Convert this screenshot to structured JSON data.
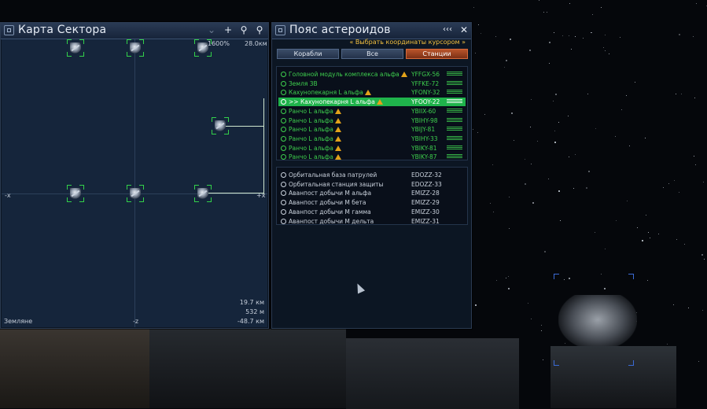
{
  "sector_map": {
    "title": "Карта Сектора",
    "zoom": "1600%",
    "range": "28.0км",
    "axis_neg_x": "-x",
    "axis_pos_x": "+x",
    "axis_neg_z": "-z",
    "sector_name": "Земляне",
    "scale_1": "19.7 км",
    "scale_2": "532 м",
    "scale_3": "-48.7 км",
    "object_icons": [
      "station-icon",
      "station-icon",
      "station-icon",
      "station-icon",
      "station-icon",
      "station-icon",
      "station-icon"
    ]
  },
  "asteroid_panel": {
    "title": "Пояс астероидов",
    "cursor_link": "« Выбрать координаты курсором »",
    "tabs": [
      "Корабли",
      "Все",
      "Станции"
    ],
    "active_tab": "Станции",
    "owned": [
      {
        "name": "Головной модуль комплекса альфа",
        "code": "YFFGX-56",
        "warn": true,
        "selected": false
      },
      {
        "name": "Земля 3В",
        "code": "YFFKE-72",
        "warn": false,
        "selected": false
      },
      {
        "name": "Кахунопекарня L альфа",
        "code": "YFONY-32",
        "warn": true,
        "selected": false
      },
      {
        "name": ">> Кахунопекарня L альфа",
        "code": "YFOOY-22",
        "warn": true,
        "selected": true
      },
      {
        "name": "Ранчо L альфа",
        "code": "YBIIX-60",
        "warn": true,
        "selected": false
      },
      {
        "name": "Ранчо L альфа",
        "code": "YBIHY-98",
        "warn": true,
        "selected": false
      },
      {
        "name": "Ранчо L альфа",
        "code": "YBIJY-81",
        "warn": true,
        "selected": false
      },
      {
        "name": "Ранчо L альфа",
        "code": "YBIHY-33",
        "warn": true,
        "selected": false
      },
      {
        "name": "Ранчо L альфа",
        "code": "YBIKY-81",
        "warn": true,
        "selected": false
      },
      {
        "name": "Ранчо L альфа",
        "code": "YBIKY-87",
        "warn": true,
        "selected": false
      }
    ],
    "other": [
      {
        "name": "Орбитальная база патрулей",
        "code": "EDOZZ-32"
      },
      {
        "name": "Орбитальная станция защиты",
        "code": "EDOZZ-33"
      },
      {
        "name": "Аванпост добычи М альфа",
        "code": "EMIZZ-28"
      },
      {
        "name": "Аванпост добычи М бета",
        "code": "EMIZZ-29"
      },
      {
        "name": "Аванпост добычи М гамма",
        "code": "EMIZZ-30"
      },
      {
        "name": "Аванпост добычи М дельта",
        "code": "EMIZZ-31"
      }
    ]
  },
  "colors": {
    "own_station": "#3ecf4e",
    "selected_row": "#1fb34b",
    "warning": "#e3a21a",
    "cursor_link": "#f2c040",
    "active_tab": "#b9542a"
  }
}
